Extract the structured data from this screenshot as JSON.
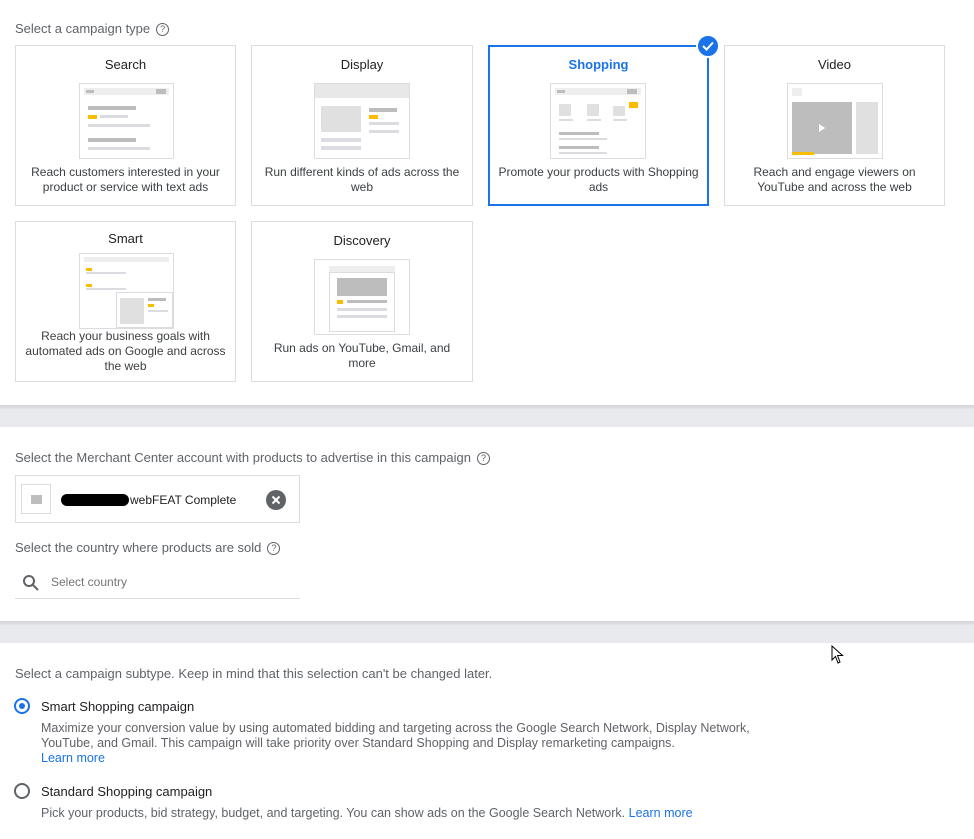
{
  "campaign_type": {
    "header": "Select a campaign type",
    "cards": [
      {
        "title": "Search",
        "description": "Reach customers interested in your product or service with text ads"
      },
      {
        "title": "Display",
        "description": "Run different kinds of ads across the web"
      },
      {
        "title": "Shopping",
        "description": "Promote your products with Shopping ads"
      },
      {
        "title": "Video",
        "description": "Reach and engage viewers on YouTube and across the web"
      },
      {
        "title": "Smart",
        "description": "Reach your business goals with automated ads on Google and across the web"
      },
      {
        "title": "Discovery",
        "description": "Run ads on YouTube, Gmail, and more"
      }
    ],
    "selected": "Shopping"
  },
  "merchant": {
    "label": "Select the Merchant Center account with products to advertise in this campaign",
    "account_name": "webFEAT Complete"
  },
  "country": {
    "label": "Select the country where products are sold",
    "placeholder": "Select country"
  },
  "subtype": {
    "label": "Select a campaign subtype. Keep in mind that this selection can't be changed later.",
    "options": [
      {
        "title": "Smart Shopping campaign",
        "description": "Maximize your conversion value by using automated bidding and targeting across the Google Search Network, Display Network, YouTube, and Gmail. This campaign will take priority over Standard Shopping and Display remarketing campaigns.",
        "link": "Learn more",
        "selected": true
      },
      {
        "title": "Standard Shopping campaign",
        "description": "Pick your products, bid strategy, budget, and targeting. You can show ads on the Google Search Network.",
        "link": "Learn more",
        "selected": false
      }
    ]
  },
  "colors": {
    "accent": "#1a73e8",
    "highlight": "#fbbc04",
    "border": "#dadce0"
  }
}
